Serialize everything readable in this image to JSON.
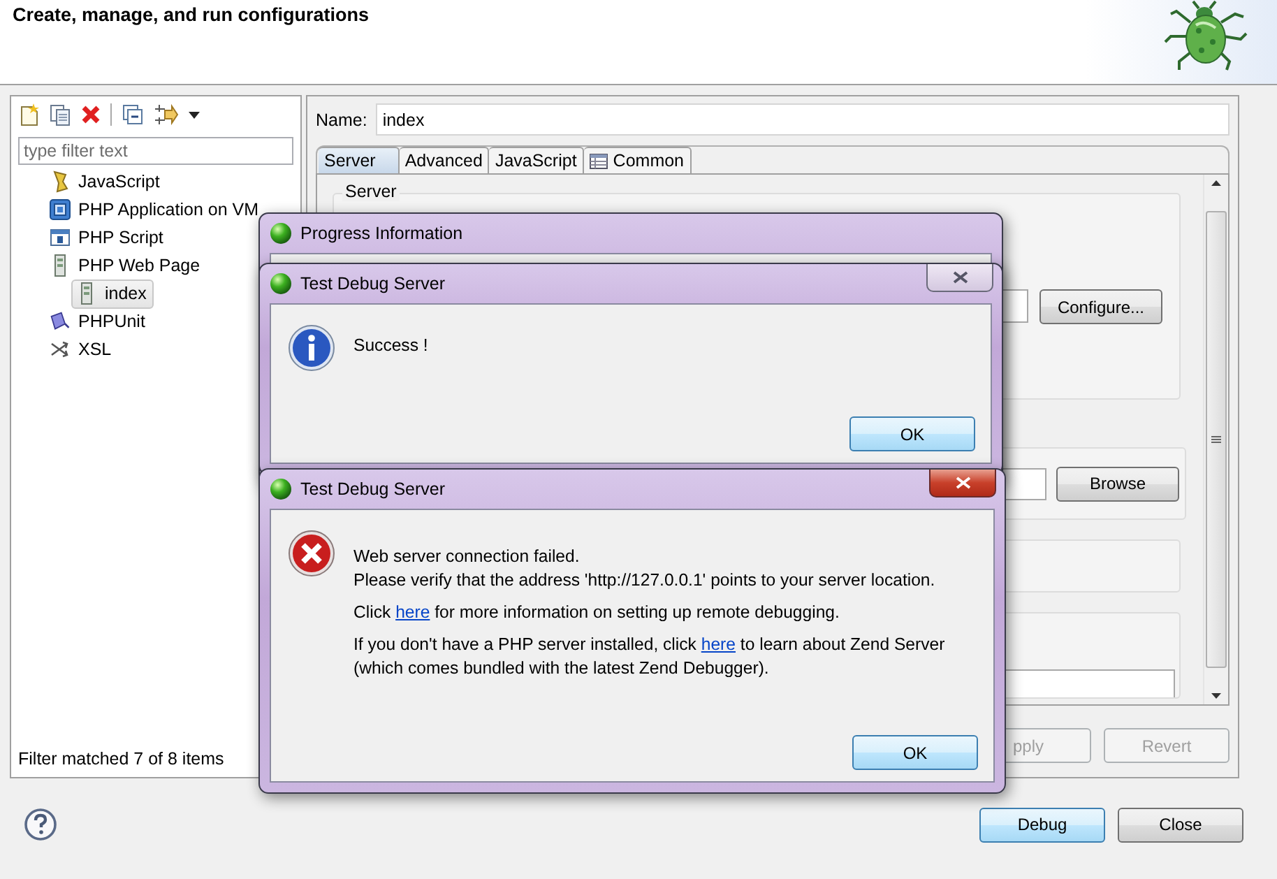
{
  "header": {
    "title": "Create, manage, and run configurations"
  },
  "filter": {
    "placeholder": "type filter text"
  },
  "tree": [
    {
      "label": "JavaScript",
      "kind": "javascript",
      "selected": false
    },
    {
      "label": "PHP Application on VM",
      "kind": "vm",
      "selected": false
    },
    {
      "label": "PHP Script",
      "kind": "script",
      "selected": false
    },
    {
      "label": "PHP Web Page",
      "kind": "webpage",
      "selected": false,
      "children": [
        {
          "label": "index",
          "kind": "webpage",
          "selected": true
        }
      ]
    },
    {
      "label": "PHPUnit",
      "kind": "phpunit",
      "selected": false
    },
    {
      "label": "XSL",
      "kind": "xsl",
      "selected": false
    }
  ],
  "filter_status": "Filter matched 7 of 8 items",
  "name_field": {
    "label": "Name:",
    "value": "index"
  },
  "tabs": [
    {
      "label": "Server",
      "kind": "plain",
      "selected": true
    },
    {
      "label": "Advanced",
      "kind": "plain",
      "selected": false
    },
    {
      "label": "JavaScript",
      "kind": "plain",
      "selected": false
    },
    {
      "label": "Common",
      "kind": "table",
      "selected": false
    }
  ],
  "server_group": {
    "title": "Server",
    "configure_button": "Configure...",
    "browse_button": "Browse"
  },
  "apply_button": {
    "label": "pply",
    "disabled": true
  },
  "revert_button": {
    "label": "Revert",
    "disabled": true
  },
  "footer_buttons": [
    {
      "label": "Debug",
      "default": true
    },
    {
      "label": "Close",
      "default": false
    }
  ],
  "progress_dialog": {
    "title": "Progress Information"
  },
  "success_dialog": {
    "title": "Test Debug Server",
    "active": false,
    "kind": "info",
    "paragraphs": [
      [
        [
          {
            "text": "Success !"
          }
        ]
      ]
    ],
    "ok_button": "OK"
  },
  "error_dialog": {
    "title": "Test Debug Server",
    "active": true,
    "kind": "error",
    "paragraphs": [
      [
        [
          {
            "text": "Web server connection failed."
          }
        ],
        [
          {
            "text": "Please verify that the address 'http://127.0.0.1' points to your server location."
          }
        ]
      ],
      [
        [
          {
            "text": "Click "
          },
          {
            "text": "here",
            "link": true
          },
          {
            "text": " for more information on setting up remote debugging."
          }
        ]
      ],
      [
        [
          {
            "text": "If you don't have a PHP server installed, click "
          },
          {
            "text": "here",
            "link": true
          },
          {
            "text": " to learn about Zend Server"
          }
        ],
        [
          {
            "text": "(which comes bundled with the latest Zend Debugger)."
          }
        ]
      ]
    ],
    "ok_button": "OK"
  }
}
